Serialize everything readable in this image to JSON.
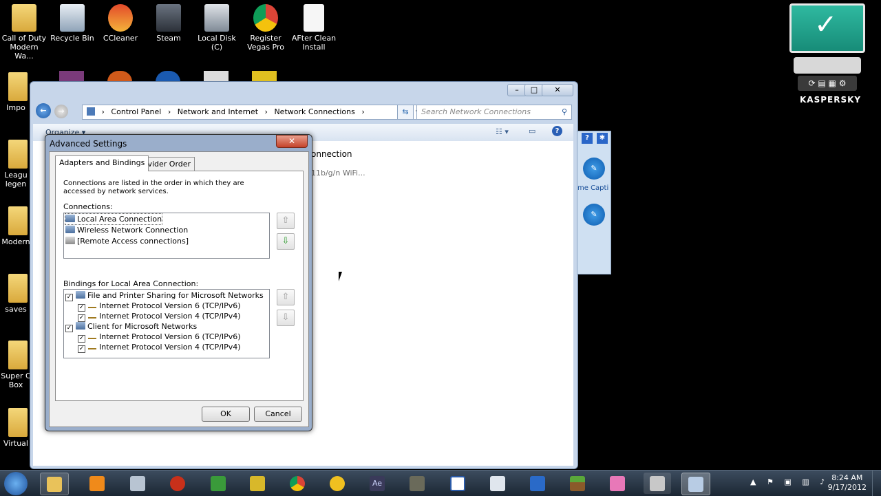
{
  "desktop": {
    "icons": [
      {
        "label": "Call of Duty Modern Wa..."
      },
      {
        "label": "Recycle Bin"
      },
      {
        "label": "CCleaner"
      },
      {
        "label": "Steam"
      },
      {
        "label": "Local Disk (C)"
      },
      {
        "label": "Register Vegas Pro"
      },
      {
        "label": "AFter Clean Install"
      }
    ],
    "side_icons": [
      {
        "label": "Impo"
      },
      {
        "label": "Leagu legen"
      },
      {
        "label": "Modern"
      },
      {
        "label": "saves"
      },
      {
        "label": "Super C Box"
      },
      {
        "label": "Virtual"
      }
    ]
  },
  "explorer": {
    "breadcrumb": [
      "Control Panel",
      "Network and Internet",
      "Network Connections"
    ],
    "search_placeholder": "Search Network Connections",
    "organize_label": "Organize",
    "content_text_1": "onnection",
    "content_text_2": "11b/g/n WiFi..."
  },
  "side_panel": {
    "label": "me Capti"
  },
  "dialog": {
    "title": "Advanced Settings",
    "close_label": "✕",
    "tabs": [
      {
        "label": "Adapters and Bindings"
      },
      {
        "label": "Provider Order"
      }
    ],
    "description": "Connections are listed in the order in which they are accessed by network services.",
    "connections_label": "Connections:",
    "connections": [
      {
        "label": "Local Area Connection"
      },
      {
        "label": "Wireless Network Connection"
      },
      {
        "label": "[Remote Access connections]"
      }
    ],
    "bindings_label": "Bindings for Local Area Connection:",
    "bindings": [
      {
        "label": "File and Printer Sharing for Microsoft Networks"
      },
      {
        "label": "Internet Protocol Version 6 (TCP/IPv6)"
      },
      {
        "label": "Internet Protocol Version 4 (TCP/IPv4)"
      },
      {
        "label": "Client for Microsoft Networks"
      },
      {
        "label": "Internet Protocol Version 6 (TCP/IPv6)"
      },
      {
        "label": "Internet Protocol Version 4 (TCP/IPv4)"
      }
    ],
    "ok_label": "OK",
    "cancel_label": "Cancel"
  },
  "kaspersky": {
    "brand": "KASPERSKY"
  },
  "taskbar": {
    "time": "8:24 AM",
    "date": "9/17/2012"
  }
}
